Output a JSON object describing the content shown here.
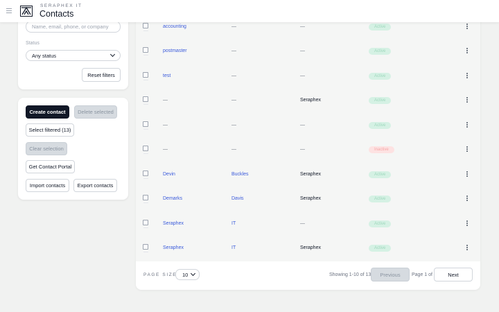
{
  "header": {
    "brand_sub": "SERAPHEX IT",
    "title": "Contacts",
    "icons": {
      "menu": "hamburger-menu-icon",
      "logo": "seraphex-logo"
    }
  },
  "filters": {
    "search_placeholder": "Name, email, phone, or company",
    "search_value": "",
    "status_label": "Status",
    "status_selected": "Any status",
    "reset_label": "Reset filters"
  },
  "actions": {
    "create": "Create contact",
    "delete_selected": "Delete selected",
    "select_filtered": "Select filtered (13)",
    "clear_selection": "Clear selection",
    "portal": "Get Contact Portal",
    "import": "Import contacts",
    "export": "Export contacts"
  },
  "table": {
    "rows": [
      {
        "first": "accounting",
        "last": "—",
        "company": "—",
        "status": "Active"
      },
      {
        "first": "postmaster",
        "last": "—",
        "company": "—",
        "status": "Active"
      },
      {
        "first": "test",
        "last": "—",
        "company": "—",
        "status": "Active"
      },
      {
        "first": "—",
        "last": "—",
        "company": "Seraphex",
        "status": "Active"
      },
      {
        "first": "—",
        "last": "—",
        "company": "—",
        "status": "Active"
      },
      {
        "first": "—",
        "last": "—",
        "company": "—",
        "status": "Inactive"
      },
      {
        "first": "Devin",
        "last": "Buckles",
        "company": "Seraphex",
        "status": "Active"
      },
      {
        "first": "Demarks",
        "last": "Davis",
        "company": "Seraphex",
        "status": "Active"
      },
      {
        "first": "Seraphex",
        "last": "IT",
        "company": "—",
        "status": "Active"
      },
      {
        "first": "Seraphex",
        "last": "IT",
        "company": "Seraphex",
        "status": "Active"
      }
    ]
  },
  "pagination": {
    "page_size_label": "PAGE SIZE",
    "page_size": "10",
    "showing": "Showing 1-10 of 13",
    "previous": "Previous",
    "page_of": "Page 1 of 2",
    "next": "Next"
  },
  "colors": {
    "primary_dark": "#111827",
    "link": "#3b5bdb",
    "active_badge_bg": "#d5f1e4",
    "inactive_badge_bg": "#fde2e2"
  }
}
